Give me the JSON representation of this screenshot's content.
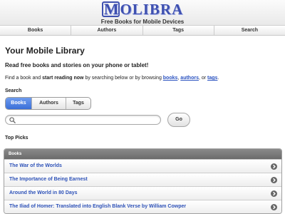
{
  "header": {
    "logo_m": "M",
    "logo_rest": "OLIBRA",
    "tagline": "Free Books for Mobile Devices"
  },
  "nav": [
    "Books",
    "Authors",
    "Tags",
    "Search"
  ],
  "main": {
    "title": "Your Mobile Library",
    "tagline": "Read free books and stories on your phone or tablet!",
    "desc_1": "Find a book and ",
    "desc_bold": "start reading now",
    "desc_2": " by searching below or by browsing ",
    "desc_link_books": "books",
    "desc_3": ", ",
    "desc_link_authors": "authors",
    "desc_4": ", or ",
    "desc_link_tags": "tags",
    "desc_5": ".",
    "search_label": "Search",
    "segments": {
      "books": "Books",
      "authors": "Authors",
      "tags": "Tags",
      "selected": "Books"
    },
    "search_value": "",
    "go_label": "Go",
    "top_picks_heading": "Top Picks",
    "list_header": "Books",
    "items": [
      "The War of the Worlds",
      "The Importance of Being Earnest",
      "Around the World in 80 Days",
      "The Iliad of Homer: Translated into English Blank Verse by William Cowper"
    ]
  },
  "colors": {
    "accent": "#3f51b0",
    "link": "#2e52b8",
    "segment_active": "#4a7fe0"
  }
}
